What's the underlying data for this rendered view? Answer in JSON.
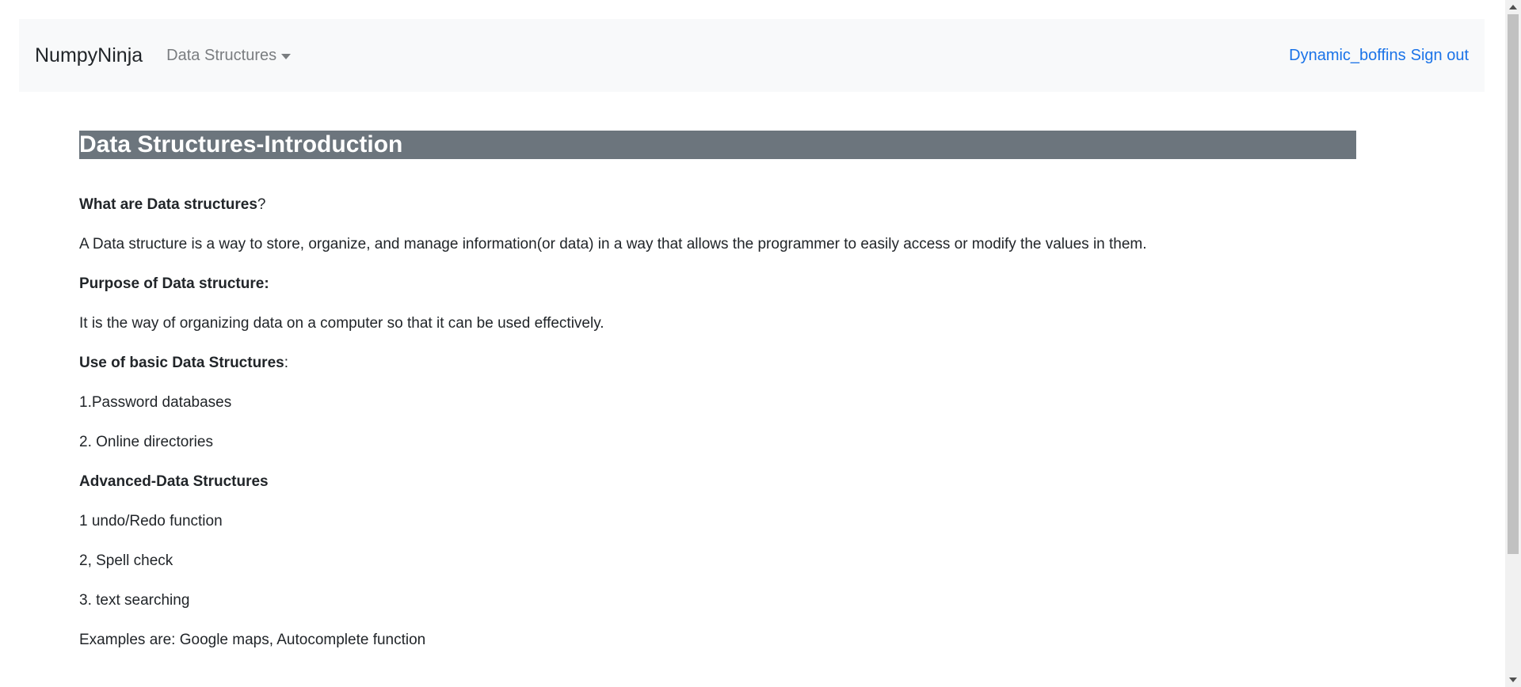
{
  "navbar": {
    "brand": "NumpyNinja",
    "dropdown_label": "Data Structures",
    "user": "Dynamic_boffins",
    "signout": "Sign out"
  },
  "page": {
    "title": "Data Structures-Introduction"
  },
  "content": {
    "q1_bold": "What are Data structures",
    "q1_suffix": "?",
    "p1": "A Data structure is a way to store, organize, and manage information(or data) in a way that allows the programmer to easily access or modify the values in them.",
    "h2": "Purpose of Data structure:",
    "p2": "It is the way of organizing data on a computer so that it can be used effectively.",
    "h3_bold": "Use of basic Data Structures",
    "h3_suffix": ":",
    "basic_items": [
      "1.Password databases",
      "2. Online directories"
    ],
    "h4": "Advanced-Data Structures",
    "advanced_items": [
      "1 undo/Redo function",
      "2, Spell check",
      "3. text searching"
    ],
    "examples": "Examples are: Google maps, Autocomplete function"
  }
}
